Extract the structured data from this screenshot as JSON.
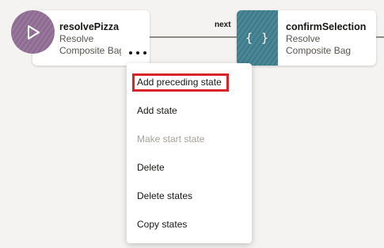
{
  "flow": {
    "edge_label": "next",
    "nodes": [
      {
        "name": "resolvePizza",
        "type_line1": "Resolve",
        "type_line2": "Composite Bag",
        "icon": "play-icon",
        "icon_color": "#8e6b92"
      },
      {
        "name": "confirmSelection",
        "type_line1": "Resolve",
        "type_line2": "Composite Bag",
        "icon": "braces-icon",
        "icon_glyph": "{ }",
        "icon_color": "#3c7c8c"
      }
    ]
  },
  "context_menu": {
    "items": [
      {
        "label": "Add preceding state",
        "enabled": true,
        "highlighted": true
      },
      {
        "label": "Add state",
        "enabled": true
      },
      {
        "label": "Make start state",
        "enabled": false
      },
      {
        "label": "Delete",
        "enabled": true
      },
      {
        "label": "Delete states",
        "enabled": true
      },
      {
        "label": "Copy states",
        "enabled": true
      }
    ]
  },
  "colors": {
    "canvas_background": "#f4f3f1",
    "highlight": "#d8232a",
    "disabled_text": "#a5a19c"
  }
}
